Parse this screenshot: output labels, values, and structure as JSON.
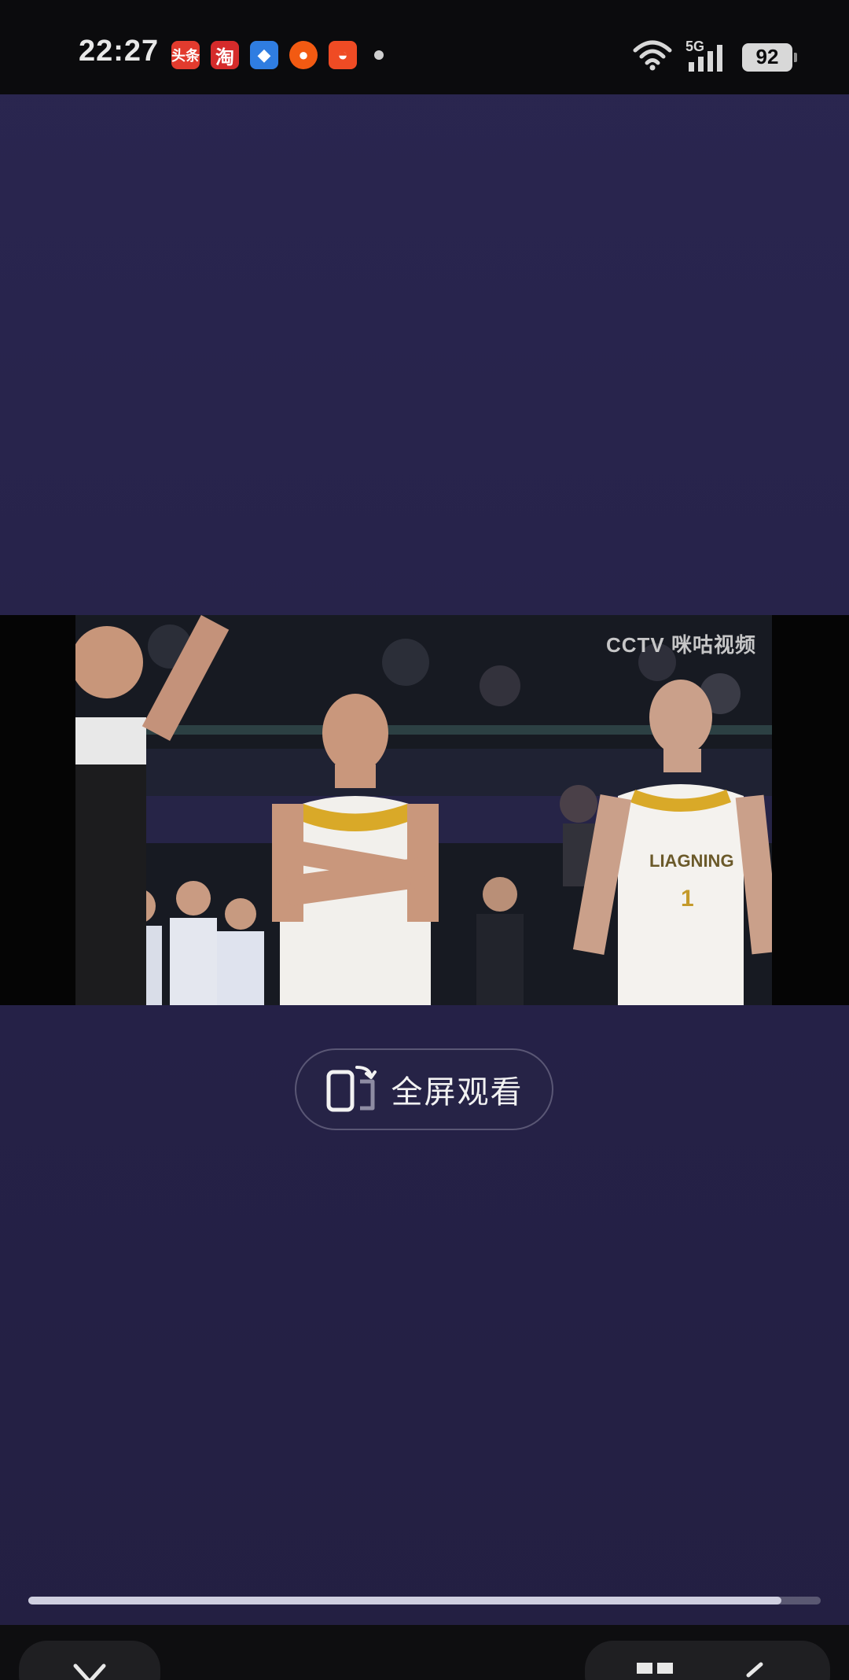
{
  "status_bar": {
    "time": "22:27",
    "notification_apps": [
      {
        "name": "toutiao-icon",
        "glyph": "头条"
      },
      {
        "name": "taobao-icon",
        "glyph": "淘"
      },
      {
        "name": "blue-app-icon",
        "glyph": "◆"
      },
      {
        "name": "orange-app-icon",
        "glyph": "●"
      },
      {
        "name": "orange-app2-icon",
        "glyph": "◒"
      }
    ],
    "network": "5G",
    "battery": "92"
  },
  "video": {
    "watermark": "CCTV 咪咕视频"
  },
  "fullscreen_button": {
    "label": "全屏观看"
  },
  "playback": {
    "progress_fraction": 0.95
  }
}
